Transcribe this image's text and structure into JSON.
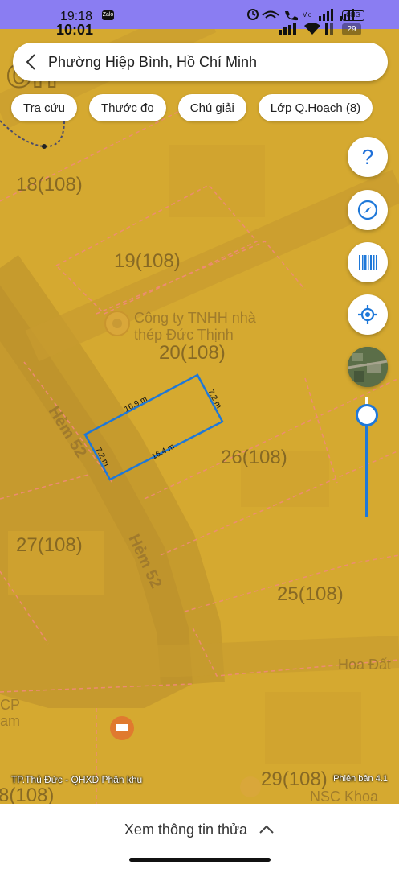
{
  "status_bar": {
    "time_primary": "19:18",
    "time_secondary": "10:01",
    "zalo_badge": "Zalo",
    "battery_primary": "CHG",
    "battery_secondary": "29"
  },
  "search": {
    "location": "Phường Hiệp Bình, Hồ Chí Minh"
  },
  "chips": [
    {
      "label": "Tra cứu"
    },
    {
      "label": "Thước đo"
    },
    {
      "label": "Chú giải"
    },
    {
      "label": "Lớp Q.Hoạch (8)"
    }
  ],
  "controls": {
    "help_symbol": "?",
    "zoom_level": 0.85
  },
  "map": {
    "parcels": [
      {
        "label": "18(108)"
      },
      {
        "label": "19(108)"
      },
      {
        "label": "20(108)"
      },
      {
        "label": "26(108)"
      },
      {
        "label": "27(108)"
      },
      {
        "label": "25(108)"
      },
      {
        "label": "29(108)"
      },
      {
        "label": "8(108)"
      }
    ],
    "streets": [
      {
        "label": "Hẻm 52"
      },
      {
        "label": "Hẻm 52"
      }
    ],
    "poi": {
      "line1": "Công ty TNHH nhà",
      "line2": "thép Đức Thịnh"
    },
    "edge_labels": {
      "top_left": "on",
      "left_1": "CP",
      "left_2": "am",
      "right_1": "Hoa Đất",
      "right_2": "NSC Khoa"
    },
    "measurements": {
      "top_side": "16.9 m",
      "right_side": "7.2 m",
      "bottom_side": "16.4 m",
      "left_side": "7.2 m"
    },
    "caption_left": "TP.Thủ Đức - QHXD Phân khu",
    "caption_right": "Phiên bản 4.1",
    "colors": {
      "base": "#d5a930",
      "boundary": "#f08a7a",
      "measure": "#1e78d9"
    }
  },
  "bottom_sheet": {
    "label": "Xem thông tin thửa"
  }
}
